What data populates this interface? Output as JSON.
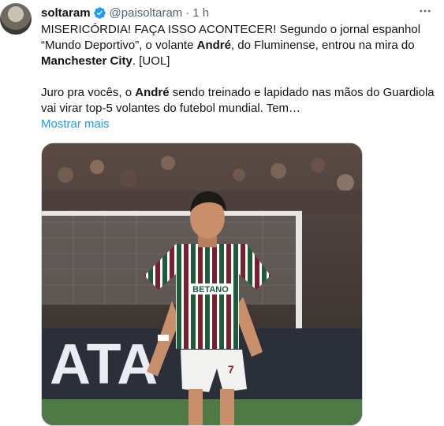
{
  "tweet": {
    "display_name": "soltaram",
    "handle": "@paisoltaram",
    "separator": "·",
    "time": "1 h",
    "line1": "MISERICÓRDIA! FAÇA ISSO ACONTECER! Segundo o jornal espanhol",
    "line2": "“Mundo Deportivo”, o volante ",
    "line2_bold": "André",
    "line2_end": ", do Fluminense, entrou na mira do",
    "line3_bold": "Manchester City",
    "line3_end": ". [UOL]",
    "p2_start": "Juro pra vocês, o ",
    "p2_bold": "André",
    "p2_end": " sendo treinado e lapidado nas mãos do Guardiola vai virar top-5 volantes do futebol mundial. Tem…",
    "show_more": "Mostrar mais"
  },
  "media": {
    "sponsor": "BETANO",
    "shirt_number": "7",
    "board_text": "ATA"
  },
  "colors": {
    "link": "#1d9bf0",
    "muted": "#536471",
    "verified": "#1d9bf0",
    "fluminense_maroon": "#7b1f2e",
    "fluminense_green": "#1f5a3a"
  },
  "icons": [
    "verified-badge-icon",
    "more-options-icon"
  ]
}
